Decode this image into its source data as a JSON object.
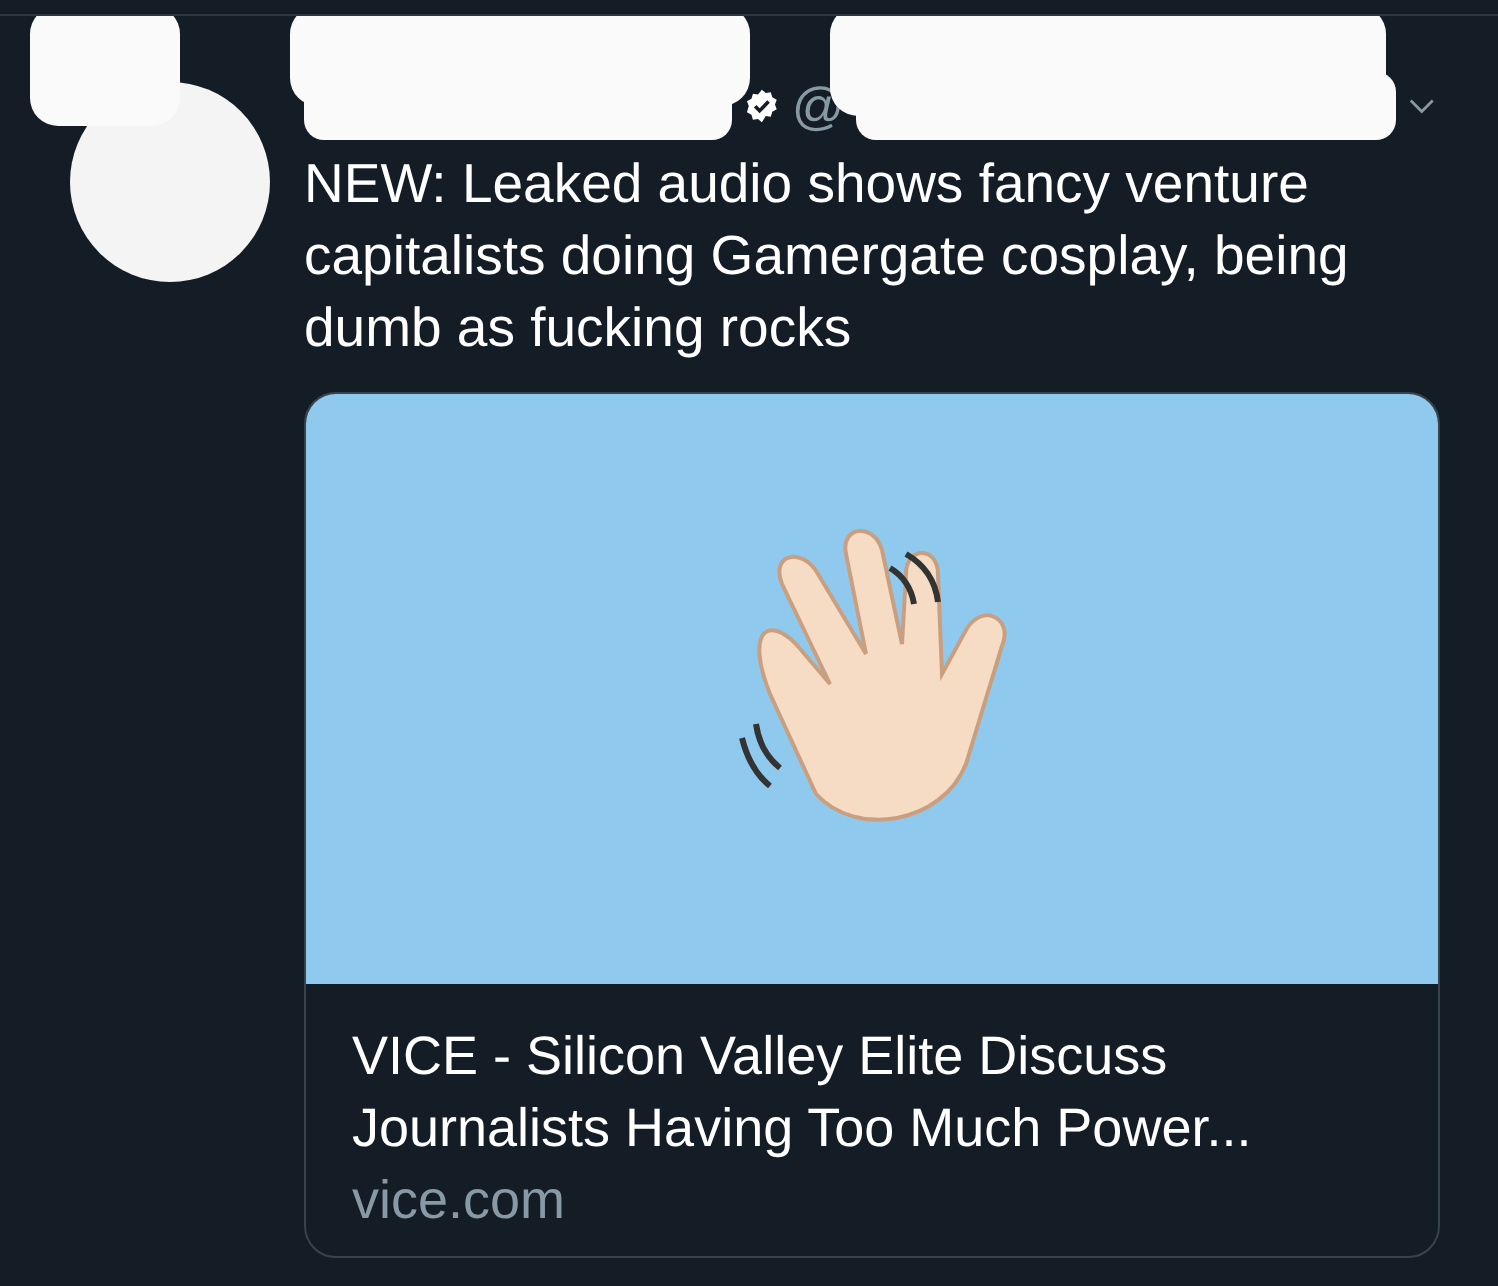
{
  "tweet": {
    "verified": true,
    "handle_prefix": "@",
    "text": "NEW: Leaked audio shows fancy venture capitalists doing Gamergate cosplay, being dumb as fucking rocks",
    "card": {
      "title": "VICE - Silicon Valley Elite Discuss Journalists Having Too Much Power...",
      "domain": "vice.com"
    }
  }
}
